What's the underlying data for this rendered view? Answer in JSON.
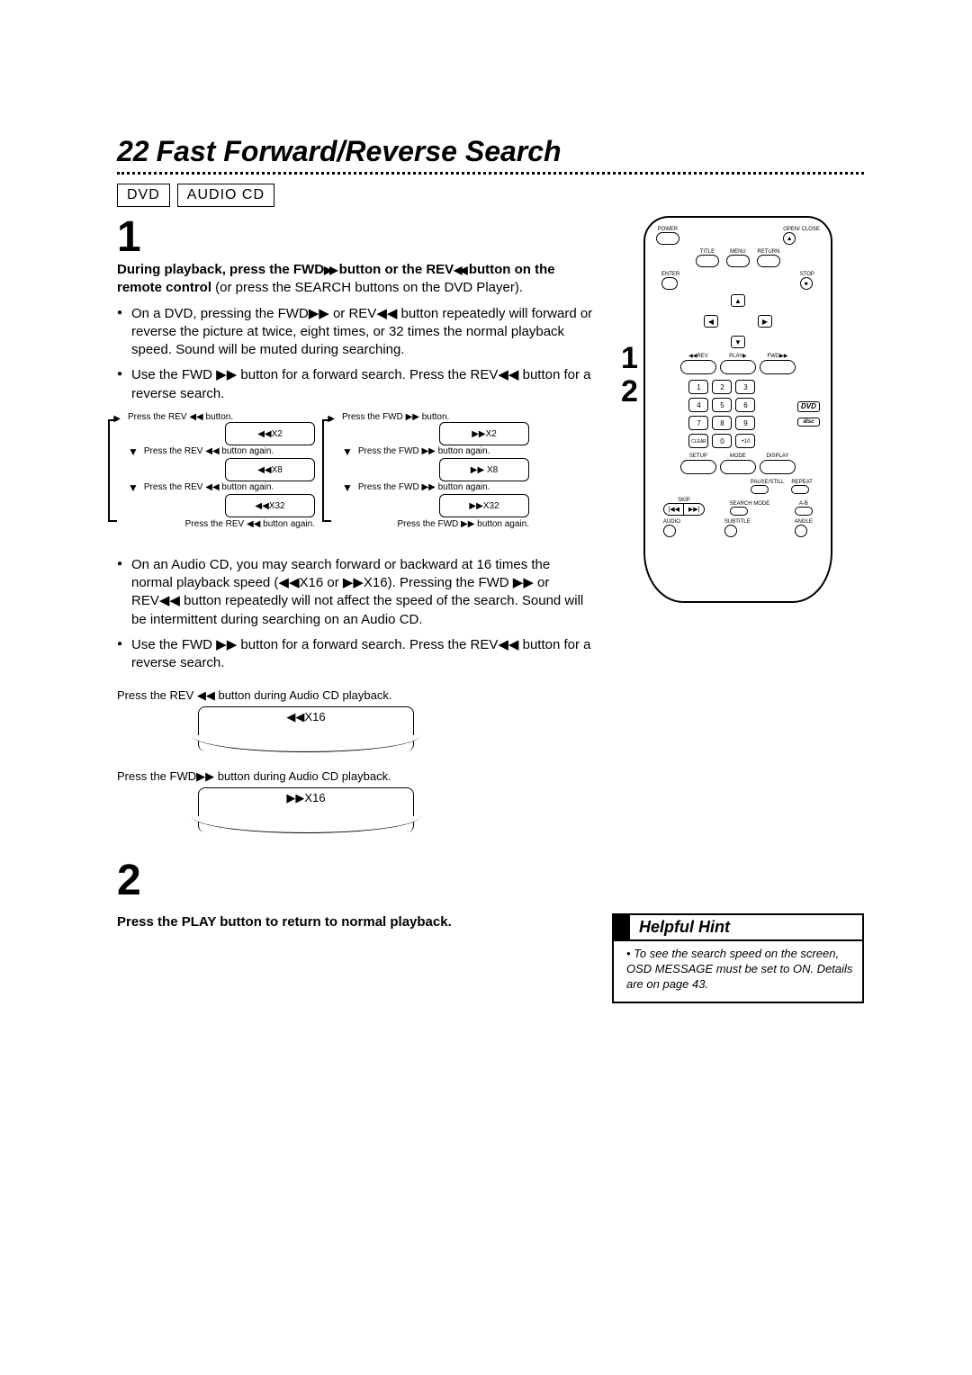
{
  "page_number": "22",
  "title": "Fast Forward/Reverse Search",
  "tags": [
    "DVD",
    "AUDIO CD"
  ],
  "step1": {
    "num": "1",
    "lead_bold": "During playback, press the FWD",
    "lead_bold2": " button or the REV",
    "lead_bold3": "button on the remote control",
    "lead_rest": " (or press the SEARCH buttons on the DVD Player).",
    "bullets": [
      "On a DVD, pressing the FWD▶▶ or REV◀◀ button repeatedly will forward or reverse the picture at twice, eight times, or 32 times the normal playback speed. Sound will be muted during searching.",
      "Use the FWD ▶▶ button for a forward search. Press the REV◀◀ button for a reverse search."
    ]
  },
  "flow_rev": {
    "top": "Press the REV ◀◀ button.",
    "s1": "◀◀X2",
    "again": "Press the REV ◀◀ button again.",
    "s2": "◀◀X8",
    "s3": "◀◀X32"
  },
  "flow_fwd": {
    "top": "Press the FWD ▶▶ button.",
    "s1": "▶▶X2",
    "again": "Press the FWD ▶▶ button again.",
    "s2": "▶▶ X8",
    "s3": "▶▶X32"
  },
  "audio_cd": {
    "bullets": [
      "On an Audio CD, you may search forward or backward at 16 times the normal playback speed (◀◀X16 or ▶▶X16). Pressing the FWD ▶▶ or REV◀◀ button repeatedly will not affect the speed of the search. Sound will be intermittent during searching on an Audio CD.",
      "Use the FWD ▶▶ button for a forward search. Press the REV◀◀ button for a reverse search."
    ],
    "rev_label": "Press the REV ◀◀ button during Audio CD playback.",
    "rev_box": "◀◀X16",
    "fwd_label": "Press the FWD▶▶ button during Audio CD playback.",
    "fwd_box": "▶▶X16"
  },
  "step2": {
    "num": "2",
    "text": "Press the PLAY button to return to normal playback."
  },
  "hint": {
    "title": "Helpful Hint",
    "body": "To see the search speed on the screen, OSD MESSAGE must be set to ON. Details are on page 43."
  },
  "remote_nums": {
    "a": "1",
    "b": "2"
  },
  "remote": {
    "power": "POWER",
    "openclose": "OPEN/\nCLOSE",
    "eject": "▲",
    "title": "TITLE",
    "menu": "MENU",
    "return": "RETURN",
    "enter": "ENTER",
    "stop": "STOP",
    "stop_sym": "■",
    "up": "▲",
    "down": "▼",
    "left": "◀",
    "right": "▶",
    "rev": "◀◀REV",
    "play": "PLAY▶",
    "fwd": "FWD▶▶",
    "keys": [
      "1",
      "2",
      "3",
      "4",
      "5",
      "6",
      "7",
      "8",
      "9",
      "CLEAR",
      "0",
      "+10"
    ],
    "dvd": "DVD",
    "disc": "disc",
    "setup": "SETUP",
    "mode": "MODE",
    "display": "DISPLAY",
    "pause": "PAUSE/STILL",
    "repeat": "REPEAT",
    "skip": "SKIP",
    "search": "SEARCH MODE",
    "ab": "A-B",
    "skip_prev": "|◀◀",
    "skip_next": "▶▶|",
    "audio": "AUDIO",
    "subtitle": "SUBTITLE",
    "angle": "ANGLE"
  }
}
